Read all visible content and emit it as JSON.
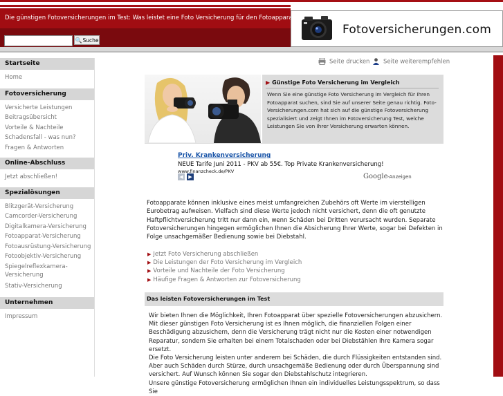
{
  "header": {
    "tagline": "Die günstigen Fotoversicherungen im Test: Was leistet eine Foto Versicherung für den Fotoapparat im Ve",
    "logo_text": "Fotoversicherungen.com",
    "search": {
      "placeholder": "",
      "button_label": "Suche"
    }
  },
  "actions": {
    "print": "Seite drucken",
    "recommend": "Seite weiterempfehlen"
  },
  "sidebar": {
    "sections": [
      {
        "title": "Startseite",
        "items": [
          "Home"
        ]
      },
      {
        "title": "Fotoversicherung",
        "items": [
          "Versicherte Leistungen",
          "Beitragsübersicht",
          "Vorteile & Nachteile",
          "Schadensfall - was nun?",
          "Fragen & Antworten"
        ]
      },
      {
        "title": "Online-Abschluss",
        "items": [
          "Jetzt abschließen!"
        ]
      },
      {
        "title": "Spezialösungen",
        "items": [
          "Blitzgerät-Versicherung",
          "Camcorder-Versicherung",
          "Digitalkamera-Versicherung",
          "Fotoapparat-Versicherung",
          "Fotoausrüstung-Versicherung",
          "Fotoobjektiv-Versicherung",
          "Spiegelreflexkamera-Versicherung",
          "Stativ-Versicherung"
        ]
      },
      {
        "title": "Unternehmen",
        "items": [
          "Impressum"
        ]
      }
    ]
  },
  "intro": {
    "title": "Günstige Foto Versicherung im Vergleich",
    "text": "Wenn Sie eine günstige Foto Versicherung im Vergleich für Ihren Fotoapparat suchen, sind Sie auf unserer Seite genau richtig. Foto-Versicherungen.com hat sich auf die günstige Fotoversicherung spezialisiert und zeigt Ihnen im Fotoversicherung Test, welche Leistungen Sie von Ihrer Versicherung erwarten können."
  },
  "ad": {
    "title": "Priv. Krankenversicherung",
    "text": "NEUE Tarife Juni 2011 - PKV ab 55€. Top Private Krankenversicherung!",
    "url": "www.finanzcheck.de/PKV",
    "google": "Google",
    "label": "-Anzeigen"
  },
  "main": {
    "paragraph": "Fotoapparate können inklusive eines meist umfangreichen Zubehörs oft Werte im vierstelligen Eurobetrag aufweisen. Vielfach sind diese Werte jedoch nicht versichert, denn die oft genutzte Haftpflichtversicherung tritt nur dann ein, wenn Schäden bei Dritten verursacht wurden. Separate Fotoversicherungen hingegen ermöglichen Ihnen die Absicherung Ihrer Werte, sogar bei Defekten in Folge unsachgemäßer Bedienung sowie bei Diebstahl.",
    "links": [
      "Jetzt Foto Versicherung abschließen",
      "Die Leistungen der Foto Versicherung im Vergleich",
      "Vorteile und Nachteile der Foto Versicherung",
      "Häufige Fragen & Antworten zur Fotoversicherung"
    ],
    "section_title": "Das leisten Fotoversicherungen im Test",
    "section_text": "Wir bieten Ihnen die Möglichkeit, Ihren Fotoapparat über spezielle Fotoversicherungen abzusichern. Mit dieser günstigen Foto Versicherung ist es Ihnen möglich, die finanziellen Folgen einer Beschädigung abzusichern, denn die Versicherung trägt nicht nur die Kosten einer notwendigen Reparatur, sondern Sie erhalten bei einem Totalschaden oder bei Diebstählen Ihre Kamera sogar ersetzt.",
    "section_text2": "Die Foto Versicherung leisten unter anderem bei Schäden, die durch Flüssigkeiten entstanden sind. Aber auch Schäden durch Stürze, durch unsachgemäße Bedienung oder durch Überspannung sind versichert. Auf Wunsch können Sie sogar den Diebstahlschutz integrieren.",
    "section_text3": "Unsere günstige Fotoversicherung ermöglichen Ihnen ein individuelles Leistungsspektrum, so dass Sie"
  },
  "colors": {
    "brand_red": "#a10d12",
    "dark_red": "#7a0a0e",
    "link_blue": "#1a55a8"
  }
}
